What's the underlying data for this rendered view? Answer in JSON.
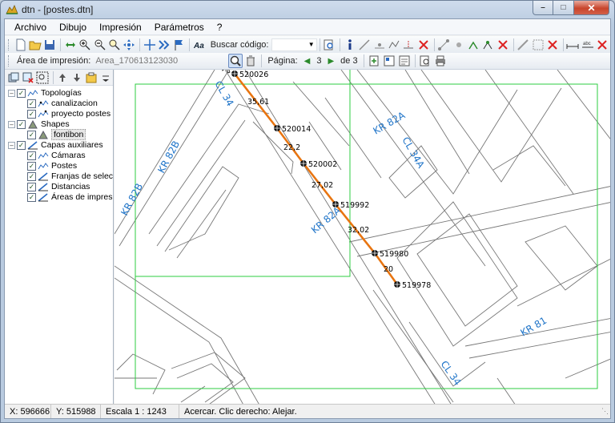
{
  "window": {
    "title": "dtn - [postes.dtn]"
  },
  "menu": {
    "items": [
      "Archivo",
      "Dibujo",
      "Impresión",
      "Parámetros",
      "?"
    ]
  },
  "toolbar": {
    "search_label": "Buscar código:",
    "search_value": "",
    "area_label": "Área de impresión:",
    "area_value": "Area_170613123030",
    "page_label": "Página:",
    "page_current": "3",
    "page_of": "de 3"
  },
  "tree": {
    "topologias": "Topologías",
    "canalizacion": "canalizacion",
    "proyecto_postes": "proyecto postes",
    "shapes": "Shapes",
    "fontibon": "fontibon",
    "capas": "Capas auxiliares",
    "camaras": "Cámaras",
    "postes": "Postes",
    "franjas": "Franjas de selección",
    "distancias": "Distancias",
    "areas": "Áreas de impresión"
  },
  "map": {
    "street_labels": [
      "CL 34",
      "KR 82B",
      "KR 82B",
      "KR 82A",
      "CL 34A",
      "KR 82A",
      "KR 81",
      "CL 34"
    ],
    "poles": [
      "520026",
      "520014",
      "520002",
      "519992",
      "519980",
      "519978"
    ],
    "distances": [
      "35,61",
      "22,2",
      "27,02",
      "32,02",
      "20"
    ],
    "colors": {
      "line": "#e87511",
      "street_label": "#1f74c8",
      "print_area": "#2ecc40"
    }
  },
  "status": {
    "x": "X: 596666",
    "y": "Y: 515988",
    "scale": "Escala  1 : 1243",
    "hint": "Acercar. Clic derecho: Alejar."
  }
}
